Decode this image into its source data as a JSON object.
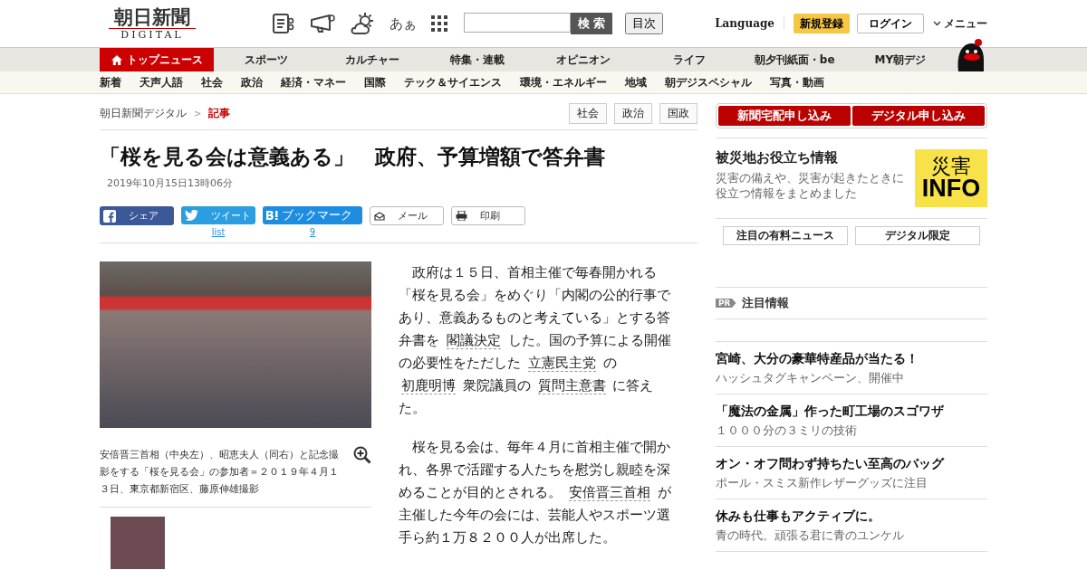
{
  "header": {
    "logo_main": "朝日新聞",
    "logo_sub": "DIGITAL",
    "font_size_label": "あぁ",
    "search": {
      "button": "検 索"
    },
    "index_button": "目次",
    "language": "Language",
    "register": "新規登録",
    "login": "ログイン",
    "menu": "メニュー"
  },
  "main_nav": [
    {
      "label": "トップニュース",
      "selected": true
    },
    {
      "label": "スポーツ",
      "selected": false
    },
    {
      "label": "カルチャー",
      "selected": false
    },
    {
      "label": "特集・連載",
      "selected": false
    },
    {
      "label": "オピニオン",
      "selected": false
    },
    {
      "label": "ライフ",
      "selected": false
    },
    {
      "label": "朝夕刊紙面・be",
      "selected": false
    },
    {
      "label": "MY朝デジ",
      "selected": false
    }
  ],
  "sub_nav": [
    "新着",
    "天声人語",
    "社会",
    "政治",
    "経済・マネー",
    "国際",
    "テック＆サイエンス",
    "環境・エネルギー",
    "地域",
    "朝デジスペシャル",
    "写真・動画"
  ],
  "breadcrumb": [
    {
      "label": "朝日新聞デジタル",
      "current": false
    },
    {
      "label": "記事",
      "current": true
    }
  ],
  "breadcrumb_separator": ">",
  "tags": [
    "社会",
    "政治",
    "国政"
  ],
  "article": {
    "title": "「桜を見る会は意義ある」　政府、予算増額で答弁書",
    "date": "2019年10月15日13時06分",
    "share": [
      {
        "kind": "facebook",
        "label": "シェア"
      },
      {
        "kind": "twitter",
        "label": "ツイート",
        "count": "list"
      },
      {
        "kind": "hatena",
        "label": "ブックマーク",
        "count": "9"
      },
      {
        "kind": "mail",
        "label": "メール"
      },
      {
        "kind": "print",
        "label": "印刷"
      }
    ],
    "caption": "安倍晋三首相（中央左）、昭恵夫人（同右）と記念撮影をする「桜を見る会」の参加者＝２０１９年４月１３日、東京都新宿区、藤原伸雄撮影",
    "paragraphs": [
      [
        {
          "kind": "text",
          "text": "　政府は１５日、首相主催で毎春開かれる「桜を見る会」をめぐり「内閣の公的行事であり、意義あるものと考えている」とする答弁書を "
        },
        {
          "kind": "link",
          "text": "閣議決定"
        },
        {
          "kind": "text",
          "text": " した。国の予算による開催の必要性をただした "
        },
        {
          "kind": "link",
          "text": "立憲民主党"
        },
        {
          "kind": "text",
          "text": " の "
        },
        {
          "kind": "link",
          "text": "初鹿明博"
        },
        {
          "kind": "text",
          "text": " 衆院議員の "
        },
        {
          "kind": "link",
          "text": "質問主意書"
        },
        {
          "kind": "text",
          "text": " に答えた。"
        }
      ],
      [
        {
          "kind": "text",
          "text": "　桜を見る会は、毎年４月に首相主催で開かれ、各界で活躍する人たちを慰労し親睦を深めることが目的とされる。 "
        },
        {
          "kind": "link",
          "text": "安倍晋三首相"
        },
        {
          "kind": "text",
          "text": " が主催した今年の会には、芸能人やスポーツ選手ら約１万８２００人が出席した。"
        }
      ]
    ]
  },
  "sidebar": {
    "subscribe": [
      "新聞宅配申し込み",
      "デジタル申し込み"
    ],
    "disaster": {
      "title": "被災地お役立ち情報",
      "text": "災害の備えや、災害が起きたときに役立つ情報をまとめました",
      "logo_top": "災害",
      "logo_bottom": "INFO"
    },
    "buttons": [
      "注目の有料ニュース",
      "デジタル限定"
    ],
    "pr_badge": "PR",
    "pr_title": "注目情報",
    "pr_items": [
      {
        "title": "宮崎、大分の豪華特産品が当たる！",
        "text": "ハッシュタグキャンペーン、開催中"
      },
      {
        "title": "「魔法の金属」作った町工場のスゴワザ",
        "text": "１０００分の３ミリの技術"
      },
      {
        "title": "オン・オフ問わず持ちたい至高のバッグ",
        "text": "ポール・スミス新作レザーグッズに注目"
      },
      {
        "title": "休みも仕事もアクティブに。",
        "text": "青の時代。頑張る君に青のユンケル"
      }
    ]
  }
}
